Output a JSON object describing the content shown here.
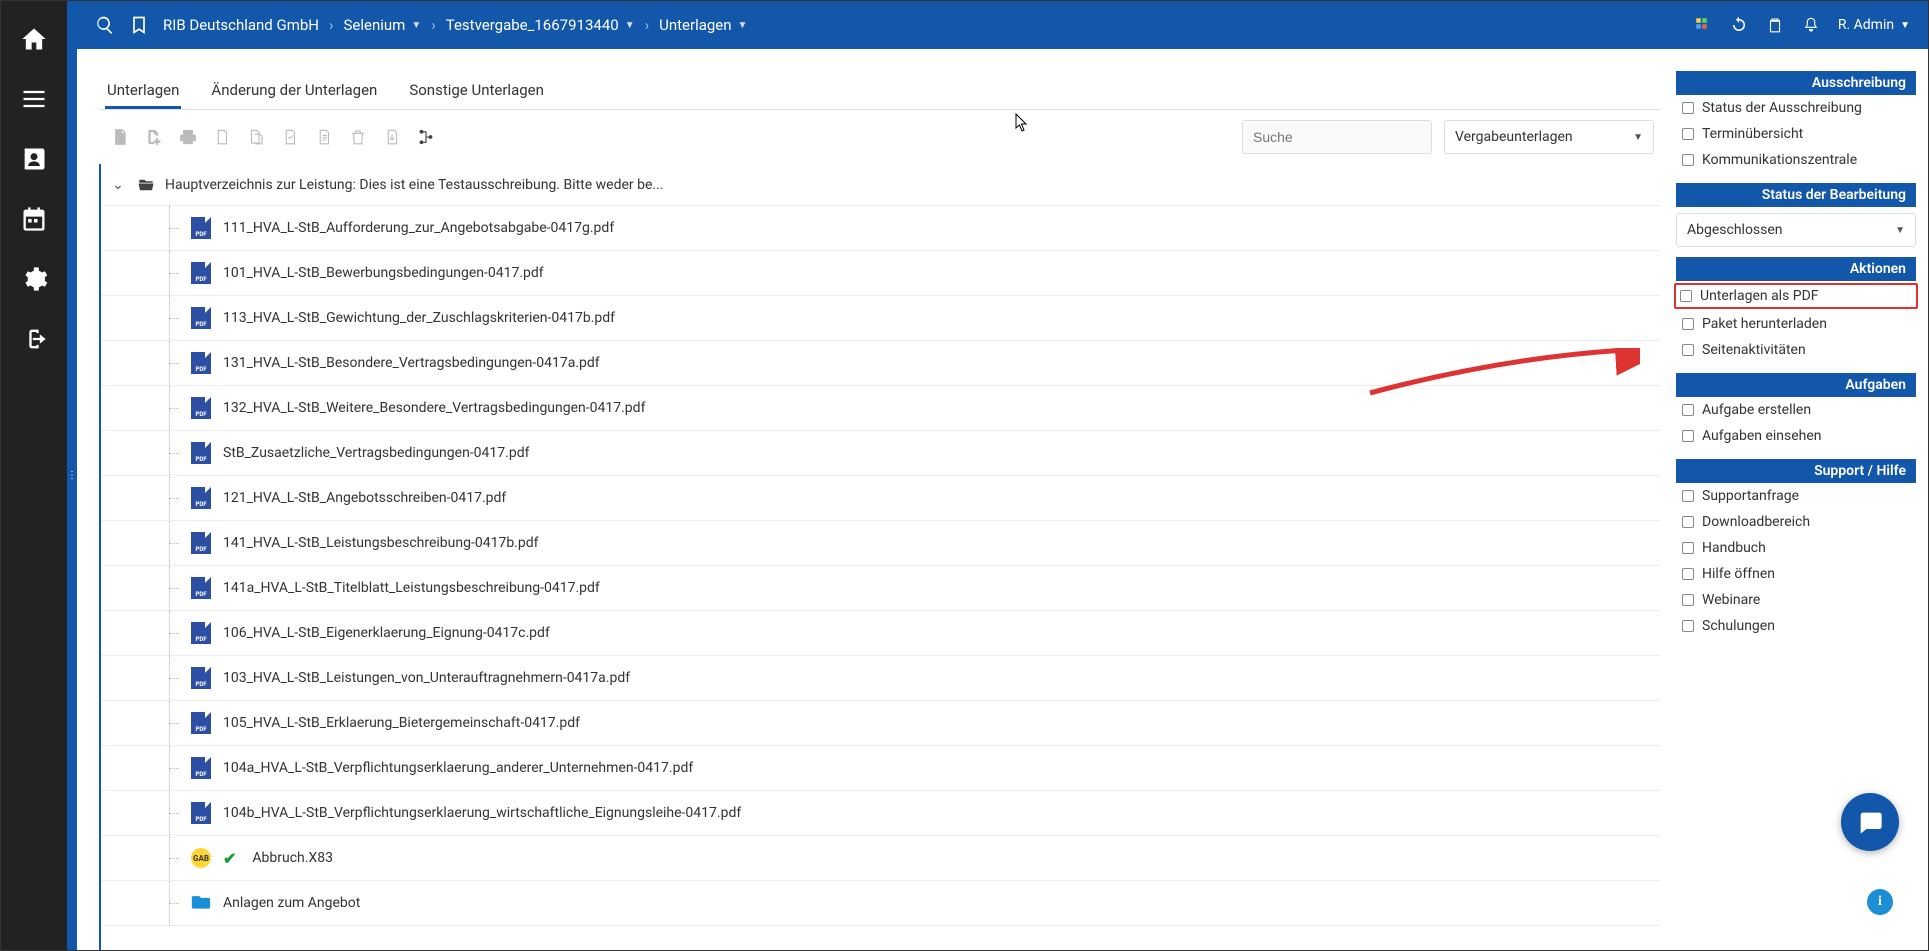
{
  "breadcrumb": {
    "org": "RIB Deutschland GmbH",
    "project": "Selenium",
    "tender": "Testvergabe_1667913440",
    "section": "Unterlagen"
  },
  "user": "R. Admin",
  "tabs": [
    {
      "label": "Unterlagen",
      "active": true
    },
    {
      "label": "Änderung der Unterlagen",
      "active": false
    },
    {
      "label": "Sonstige Unterlagen",
      "active": false
    }
  ],
  "search": {
    "placeholder": "Suche"
  },
  "typeSelect": {
    "value": "Vergabeunterlagen"
  },
  "tree": {
    "rootLabel": "Hauptverzeichnis zur Leistung: Dies ist eine Testausschreibung. Bitte weder be...",
    "items": [
      {
        "type": "pdf",
        "name": "111_HVA_L-StB_Aufforderung_zur_Angebotsabgabe-0417g.pdf"
      },
      {
        "type": "pdf",
        "name": "101_HVA_L-StB_Bewerbungsbedingungen-0417.pdf"
      },
      {
        "type": "pdf",
        "name": "113_HVA_L-StB_Gewichtung_der_Zuschlagskriterien-0417b.pdf"
      },
      {
        "type": "pdf",
        "name": "131_HVA_L-StB_Besondere_Vertragsbedingungen-0417a.pdf"
      },
      {
        "type": "pdf",
        "name": "132_HVA_L-StB_Weitere_Besondere_Vertragsbedingungen-0417.pdf"
      },
      {
        "type": "pdf",
        "name": "StB_Zusaetzliche_Vertragsbedingungen-0417.pdf"
      },
      {
        "type": "pdf",
        "name": "121_HVA_L-StB_Angebotsschreiben-0417.pdf"
      },
      {
        "type": "pdf",
        "name": "141_HVA_L-StB_Leistungsbeschreibung-0417b.pdf"
      },
      {
        "type": "pdf",
        "name": "141a_HVA_L-StB_Titelblatt_Leistungsbeschreibung-0417.pdf"
      },
      {
        "type": "pdf",
        "name": "106_HVA_L-StB_Eigenerklaerung_Eignung-0417c.pdf"
      },
      {
        "type": "pdf",
        "name": "103_HVA_L-StB_Leistungen_von_Unterauftragnehmern-0417a.pdf"
      },
      {
        "type": "pdf",
        "name": "105_HVA_L-StB_Erklaerung_Bietergemeinschaft-0417.pdf"
      },
      {
        "type": "pdf",
        "name": "104a_HVA_L-StB_Verpflichtungserklaerung_anderer_Unternehmen-0417.pdf"
      },
      {
        "type": "pdf",
        "name": "104b_HVA_L-StB_Verpflichtungserklaerung_wirtschaftliche_Eignungsleihe-0417.pdf"
      },
      {
        "type": "gab",
        "name": "Abbruch.X83",
        "checked": true
      },
      {
        "type": "folder",
        "name": "Anlagen zum Angebot"
      }
    ]
  },
  "right": {
    "panels": [
      {
        "title": "Ausschreibung",
        "links": [
          {
            "label": "Status der Ausschreibung"
          },
          {
            "label": "Terminübersicht"
          },
          {
            "label": "Kommunikationszentrale"
          }
        ]
      },
      {
        "title": "Status der Bearbeitung",
        "status": "Abgeschlossen"
      },
      {
        "title": "Aktionen",
        "links": [
          {
            "label": "Unterlagen als PDF",
            "highlight": true
          },
          {
            "label": "Paket herunterladen"
          },
          {
            "label": "Seitenaktivitäten"
          }
        ]
      },
      {
        "title": "Aufgaben",
        "links": [
          {
            "label": "Aufgabe erstellen"
          },
          {
            "label": "Aufgaben einsehen"
          }
        ]
      },
      {
        "title": "Support / Hilfe",
        "links": [
          {
            "label": "Supportanfrage"
          },
          {
            "label": "Downloadbereich"
          },
          {
            "label": "Handbuch"
          },
          {
            "label": "Hilfe öffnen"
          },
          {
            "label": "Webinare"
          },
          {
            "label": "Schulungen"
          }
        ]
      }
    ]
  }
}
